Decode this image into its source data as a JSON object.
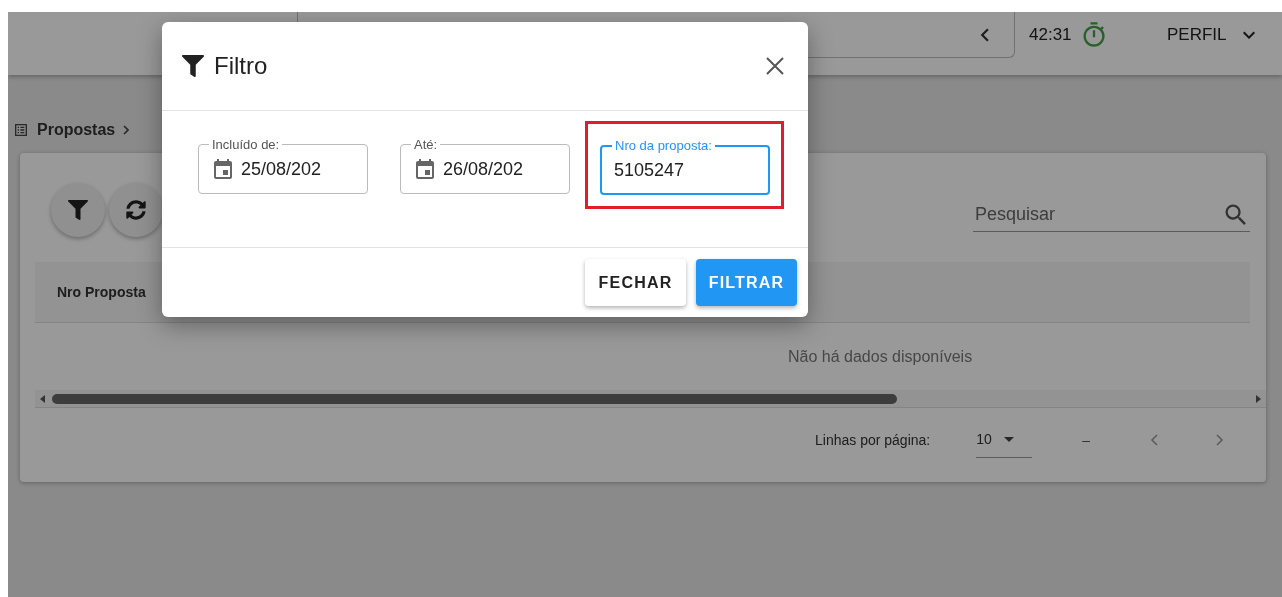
{
  "header": {
    "timer": "42:31",
    "profile": "PERFIL"
  },
  "breadcrumb": {
    "items": [
      "Propostas"
    ]
  },
  "card": {
    "search": {
      "placeholder": "Pesquisar"
    },
    "table": {
      "columns": [
        "Nro Proposta"
      ],
      "empty_message": "Não há dados disponíveis"
    },
    "pagination": {
      "rows_label": "Linhas por página:",
      "rows_per_page": "10",
      "range": "–"
    }
  },
  "dialog": {
    "title": "Filtro",
    "fields": [
      {
        "kind": "date",
        "label": "Incluído de:",
        "value": "25/08/202",
        "focused": false,
        "highlighted": false
      },
      {
        "kind": "date",
        "label": "Até:",
        "value": "26/08/202",
        "focused": false,
        "highlighted": false
      },
      {
        "kind": "text",
        "label": "Nro da proposta:",
        "value": "5105247",
        "focused": true,
        "highlighted": true
      }
    ],
    "buttons": [
      {
        "kind": "text",
        "label": "FECHAR"
      },
      {
        "kind": "primary",
        "label": "FILTRAR"
      }
    ]
  }
}
